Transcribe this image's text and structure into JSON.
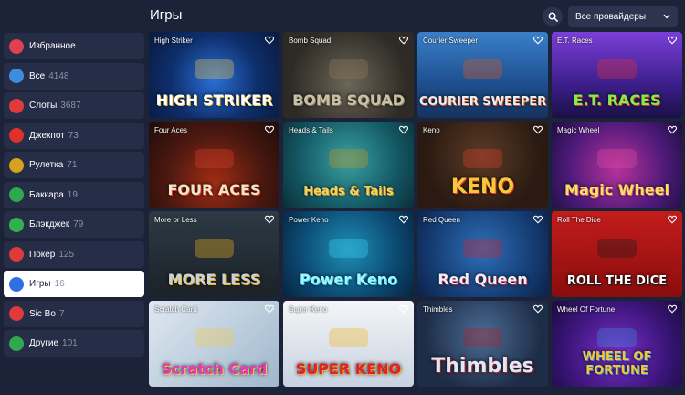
{
  "header": {
    "title": "Игры",
    "provider_select": "Все провайдеры"
  },
  "sidebar": {
    "items": [
      {
        "label": "Избранное",
        "count": "",
        "icon": "heart-icon",
        "color": "#e04050",
        "active": false
      },
      {
        "label": "Все",
        "count": "4148",
        "icon": "grid-icon",
        "color": "#3c8de0",
        "active": false
      },
      {
        "label": "Слоты",
        "count": "3687",
        "icon": "cherry-icon",
        "color": "#e03a3a",
        "active": false
      },
      {
        "label": "Джекпот",
        "count": "73",
        "icon": "jackpot-icon",
        "color": "#e0302a",
        "active": false
      },
      {
        "label": "Рулетка",
        "count": "71",
        "icon": "roulette-icon",
        "color": "#d6a21e",
        "active": false
      },
      {
        "label": "Баккара",
        "count": "19",
        "icon": "baccarat-icon",
        "color": "#2fa84f",
        "active": false
      },
      {
        "label": "Блэкджек",
        "count": "79",
        "icon": "blackjack-icon",
        "color": "#33b04a",
        "active": false
      },
      {
        "label": "Покер",
        "count": "125",
        "icon": "poker-chip-icon",
        "color": "#e03a3a",
        "active": false
      },
      {
        "label": "Игры",
        "count": "16",
        "icon": "lightning-icon",
        "color": "#2f6fe0",
        "active": true
      },
      {
        "label": "Sic Bo",
        "count": "7",
        "icon": "dice-icon",
        "color": "#e03a3a",
        "active": false
      },
      {
        "label": "Другие",
        "count": "101",
        "icon": "globe-icon",
        "color": "#2fa84f",
        "active": false
      }
    ]
  },
  "games": [
    {
      "name": "High Striker",
      "logo": "HIGH STRIKER",
      "logo_color": "#ffffff",
      "accent": "#f2c94c"
    },
    {
      "name": "Bomb Squad",
      "logo": "BOMB SQUAD",
      "logo_color": "#c8c0a8",
      "accent": "#8a7c5a"
    },
    {
      "name": "Courier Sweeper",
      "logo": "COURIER SWEEPER",
      "logo_color": "#e8eef6",
      "accent": "#e05a1c"
    },
    {
      "name": "E.T. Races",
      "logo": "E.T. RACES",
      "logo_color": "#7ef04a",
      "accent": "#e0303a"
    },
    {
      "name": "Four Aces",
      "logo": "FOUR ACES",
      "logo_color": "#f2e6c8",
      "accent": "#e0402a"
    },
    {
      "name": "Heads & Tails",
      "logo": "Heads & Tails",
      "logo_color": "#f2d36a",
      "accent": "#c8961e"
    },
    {
      "name": "Keno",
      "logo": "KENO",
      "logo_color": "#f6c83a",
      "accent": "#e0402a"
    },
    {
      "name": "Magic Wheel",
      "logo": "Magic Wheel",
      "logo_color": "#f7e25a",
      "accent": "#e04aa0"
    },
    {
      "name": "More or Less",
      "logo": "MORE LESS",
      "logo_color": "#c9d2d8",
      "accent": "#f2b41e"
    },
    {
      "name": "Power Keno",
      "logo": "Power Keno",
      "logo_color": "#9ff6ff",
      "accent": "#3ad0f0"
    },
    {
      "name": "Red Queen",
      "logo": "Red Queen",
      "logo_color": "#e8f0ff",
      "accent": "#d02030"
    },
    {
      "name": "Roll The Dice",
      "logo": "ROLL THE DICE",
      "logo_color": "#ffffff",
      "accent": "#1a1a1a"
    },
    {
      "name": "Scratch Card",
      "logo": "Scratch Card",
      "logo_color": "#e83ab8",
      "accent": "#f2c94c"
    },
    {
      "name": "Super Keno",
      "logo": "SUPER KENO",
      "logo_color": "#e0202a",
      "accent": "#f2b41e"
    },
    {
      "name": "Thimbles",
      "logo": "Thimbles",
      "logo_color": "#dfe8f6",
      "accent": "#b02020"
    },
    {
      "name": "Wheel Of Fortune",
      "logo": "WHEEL OF FORTUNE",
      "logo_color": "#f2c83a",
      "accent": "#3a8ae0"
    }
  ]
}
